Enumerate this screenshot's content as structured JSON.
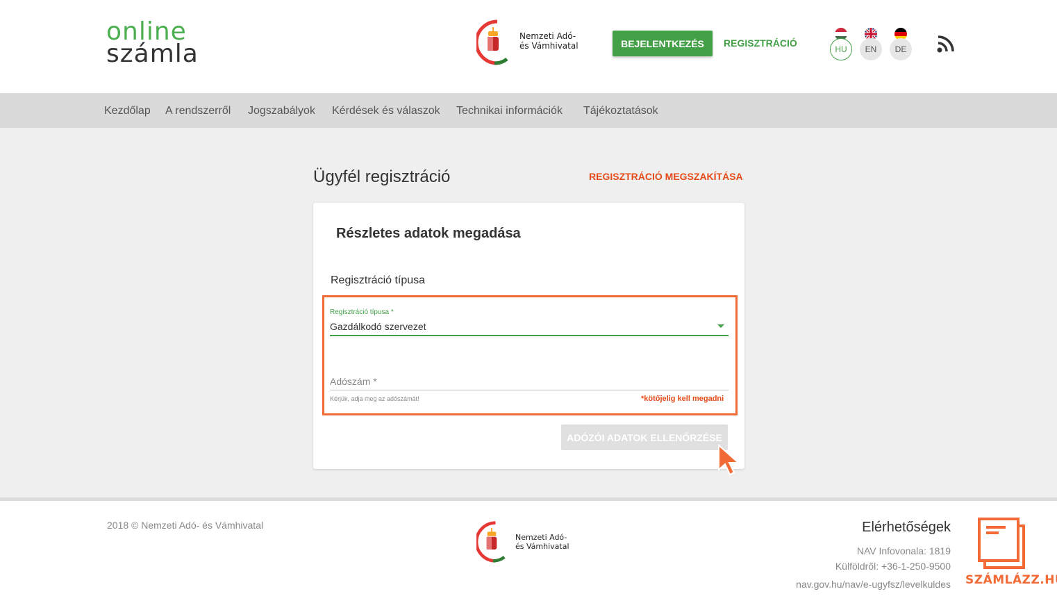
{
  "header": {
    "logo_line1": "online",
    "logo_line2": "számla",
    "nav_name_line1": "Nemzeti Adó-",
    "nav_name_line2": "és Vámhivatal",
    "login_label": "BEJELENTKEZÉS",
    "register_label": "REGISZTRÁCIÓ",
    "languages": [
      {
        "code": "HU",
        "active": true
      },
      {
        "code": "EN",
        "active": false
      },
      {
        "code": "DE",
        "active": false
      }
    ],
    "rss_icon": "rss-icon"
  },
  "nav": {
    "items": [
      "Kezdőlap",
      "A rendszerről",
      "Jogszabályok",
      "Kérdések és válaszok",
      "Technikai információk",
      "Tájékoztatások"
    ]
  },
  "main": {
    "title": "Ügyfél regisztráció",
    "cancel_label": "REGISZTRÁCIÓ MEGSZAKÍTÁSA",
    "card": {
      "title": "Részletes adatok megadása",
      "section_label": "Regisztráció típusa",
      "select": {
        "label": "Regisztráció típusa *",
        "value": "Gazdálkodó szervezet"
      },
      "tax_field": {
        "label": "Adószám *",
        "hint": "Kérjük, adja meg az adószámát!",
        "required_note": "*kötőjelig kell megadni"
      },
      "check_button": "ADÓZÓI ADATOK ELLENŐRZÉSE"
    }
  },
  "footer": {
    "copyright": "2018 © Nemzeti Adó- és Vámhivatal",
    "nav_name_line1": "Nemzeti Adó-",
    "nav_name_line2": "és Vámhivatal",
    "contact_title": "Elérhetőségek",
    "contact_lines": [
      "NAV Infovonala: 1819",
      "Külföldről: +36-1-250-9500",
      "nav.gov.hu/nav/e-ugyfsz/levelkuldes"
    ],
    "watermark": "SZÁMLÁZZ.HU"
  },
  "colors": {
    "green": "#43a047",
    "orange": "#f26a35",
    "red_link": "#e64a19"
  }
}
